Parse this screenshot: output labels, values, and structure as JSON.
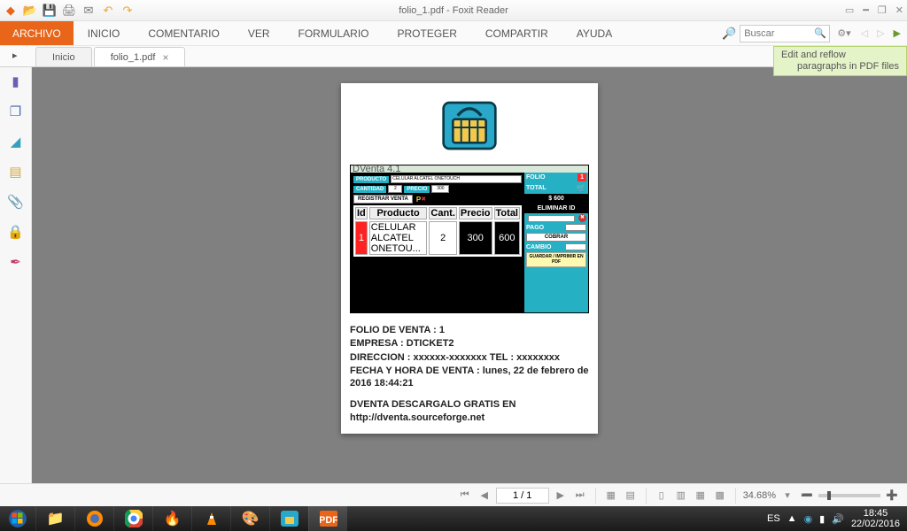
{
  "window": {
    "title": "folio_1.pdf - Foxit Reader"
  },
  "menu": {
    "file": "ARCHIVO",
    "items": [
      "INICIO",
      "COMENTARIO",
      "VER",
      "FORMULARIO",
      "PROTEGER",
      "COMPARTIR",
      "AYUDA"
    ]
  },
  "search": {
    "placeholder": "Buscar"
  },
  "tooltip": {
    "line1": "Edit and reflow",
    "line2": "paragraphs in PDF files"
  },
  "tabs": [
    {
      "label": "Inicio",
      "active": false,
      "closable": false
    },
    {
      "label": "folio_1.pdf",
      "active": true,
      "closable": true
    }
  ],
  "document": {
    "folio_line": "FOLIO DE VENTA : 1",
    "empresa": "EMPRESA : DTICKET2",
    "direccion": "DIRECCION : xxxxxx-xxxxxxx TEL : xxxxxxxx",
    "fecha": "FECHA Y HORA DE VENTA : lunes, 22 de febrero de 2016 18:44:21",
    "footer": "DVENTA DESCARGALO GRATIS EN http://dventa.sourceforge.net"
  },
  "app": {
    "title": "DVenta 4.1",
    "producto_label": "PRODUCTO",
    "producto_value": "CELULAR ALCATEL ONETOUCH",
    "cantidad_label": "CANTIDAD",
    "cantidad_value": "2",
    "precio_label": "PRECIO",
    "precio_value": "300",
    "registrar": "REGISTRAR VENTA",
    "folio_label": "FOLIO",
    "folio_value": "1",
    "total_label": "TOTAL",
    "total_value": "$ 600",
    "eliminar": "ELIMINAR ID",
    "pago_label": "PAGO",
    "cobrar": "COBRAR",
    "cambio_label": "CAMBIO",
    "guardar": "GUARDAR / IMPRIMIR EN PDF",
    "table": {
      "headers": [
        "Id",
        "Producto",
        "Cant.",
        "Precio",
        "Total"
      ],
      "row": [
        "1",
        "CELULAR ALCATEL ONETOU...",
        "2",
        "300",
        "600"
      ]
    }
  },
  "status": {
    "page_of": "1 / 1",
    "zoom": "34.68%"
  },
  "tray": {
    "lang": "ES",
    "time": "18:45",
    "date": "22/02/2016"
  }
}
